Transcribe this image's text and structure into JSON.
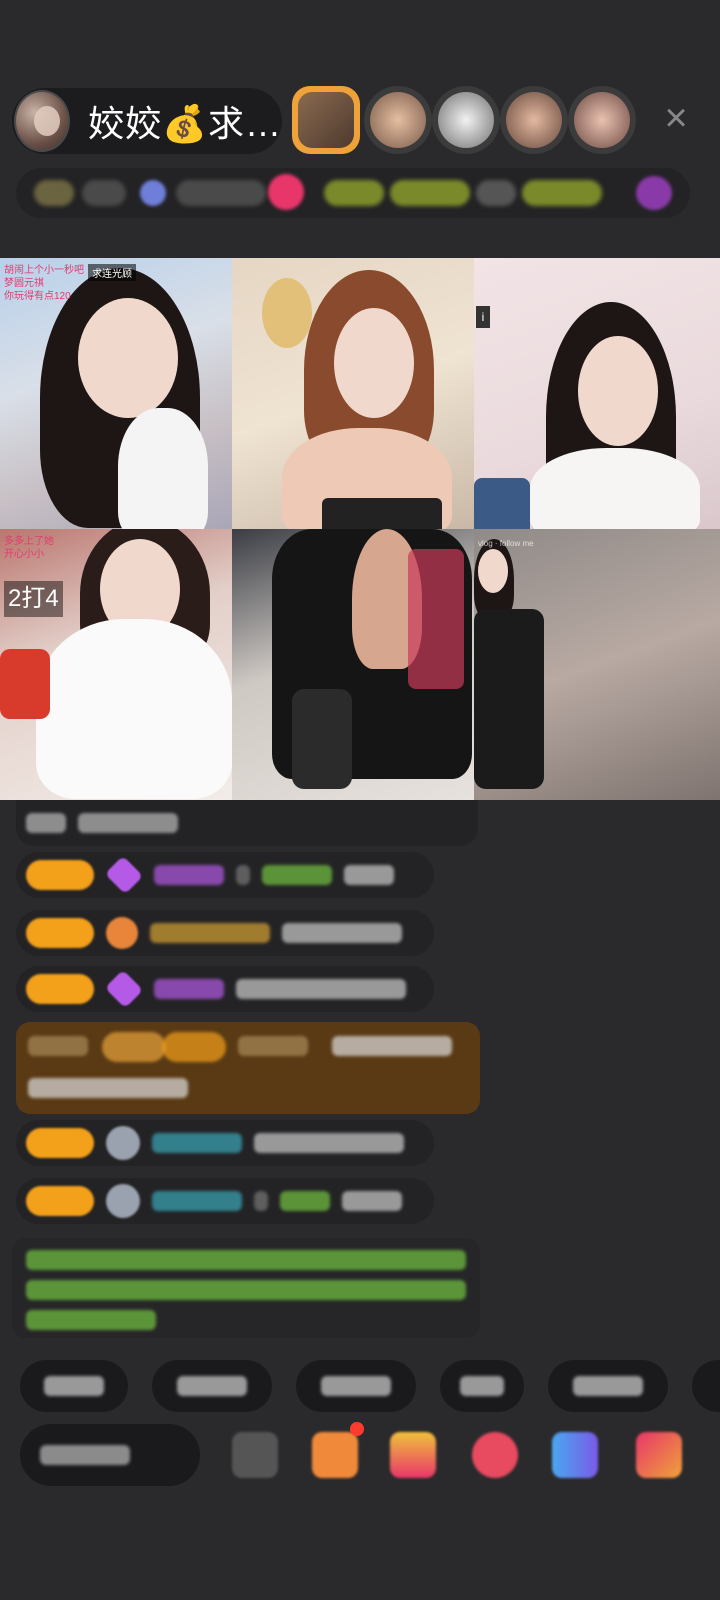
{
  "header": {
    "host_name": "姣姣💰求…",
    "close_icon": "×"
  },
  "grid": {
    "tile1_overlay": "胡闹上个小一秒吧\n梦圆元祺\n你玩得有点120",
    "tile1_badge": "求连光顾",
    "tile3_tag": "i",
    "tile4_overlay": "多多上了她\n开心小小\n",
    "tile4_score": "2打4",
    "tile6_caption": "vlog · follow me"
  },
  "colors": {
    "background": "#2a2a2c",
    "level_badge": "#f3a01a",
    "gift_message_bg": "#5a3a14",
    "green_text": "#74c441",
    "cyan_name": "#3aa8b8",
    "purple_name": "#b45ae6"
  },
  "icons": [
    "close-icon",
    "gem-icon",
    "heart-icon",
    "gift-icon",
    "message-icon"
  ]
}
